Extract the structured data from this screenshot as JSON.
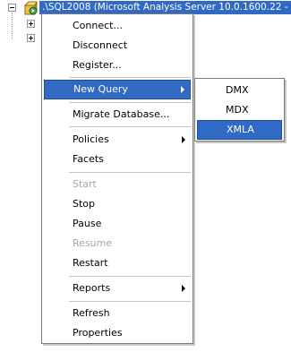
{
  "tree": {
    "server_label": ".\\SQL2008 (Microsoft Analysis Server 10.0.1600.22 -"
  },
  "context_menu": {
    "items": [
      {
        "label": "Connect..."
      },
      {
        "label": "Disconnect"
      },
      {
        "label": "Register..."
      },
      {
        "label": "New Query"
      },
      {
        "label": "Migrate Database..."
      },
      {
        "label": "Policies"
      },
      {
        "label": "Facets"
      },
      {
        "label": "Start"
      },
      {
        "label": "Stop"
      },
      {
        "label": "Pause"
      },
      {
        "label": "Resume"
      },
      {
        "label": "Restart"
      },
      {
        "label": "Reports"
      },
      {
        "label": "Refresh"
      },
      {
        "label": "Properties"
      }
    ]
  },
  "submenu": {
    "items": [
      {
        "label": "DMX"
      },
      {
        "label": "MDX"
      },
      {
        "label": "XMLA"
      }
    ]
  },
  "colors": {
    "highlight": "#316ac5",
    "disabled_text": "#a6a6a6"
  }
}
